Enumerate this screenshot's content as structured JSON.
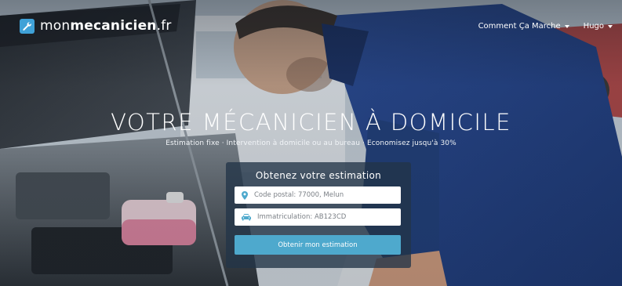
{
  "header": {
    "logo": {
      "mon": "mon",
      "mec": "mecanicien",
      "tld": ".fr"
    },
    "nav": [
      {
        "label": "Comment Ça Marche"
      },
      {
        "label": "Hugo"
      }
    ]
  },
  "hero": {
    "title": "VOTRE MÉCANICIEN À DOMICILE",
    "subtitle": "Estimation fixe · Intervention à domicile ou au bureau · Economisez jusqu'à 30%"
  },
  "estimate_card": {
    "title": "Obtenez votre estimation",
    "postal_placeholder": "Code postal: 77000, Melun",
    "immat_placeholder": "Immatriculation: AB123CD",
    "submit_label": "Obtenir mon estimation"
  },
  "icons": {
    "logo": "wrench-icon",
    "postal": "map-marker-icon",
    "immat": "car-icon"
  },
  "colors": {
    "brand": "#3fa1d7",
    "button": "#4ea9cd",
    "card": "#223448"
  }
}
